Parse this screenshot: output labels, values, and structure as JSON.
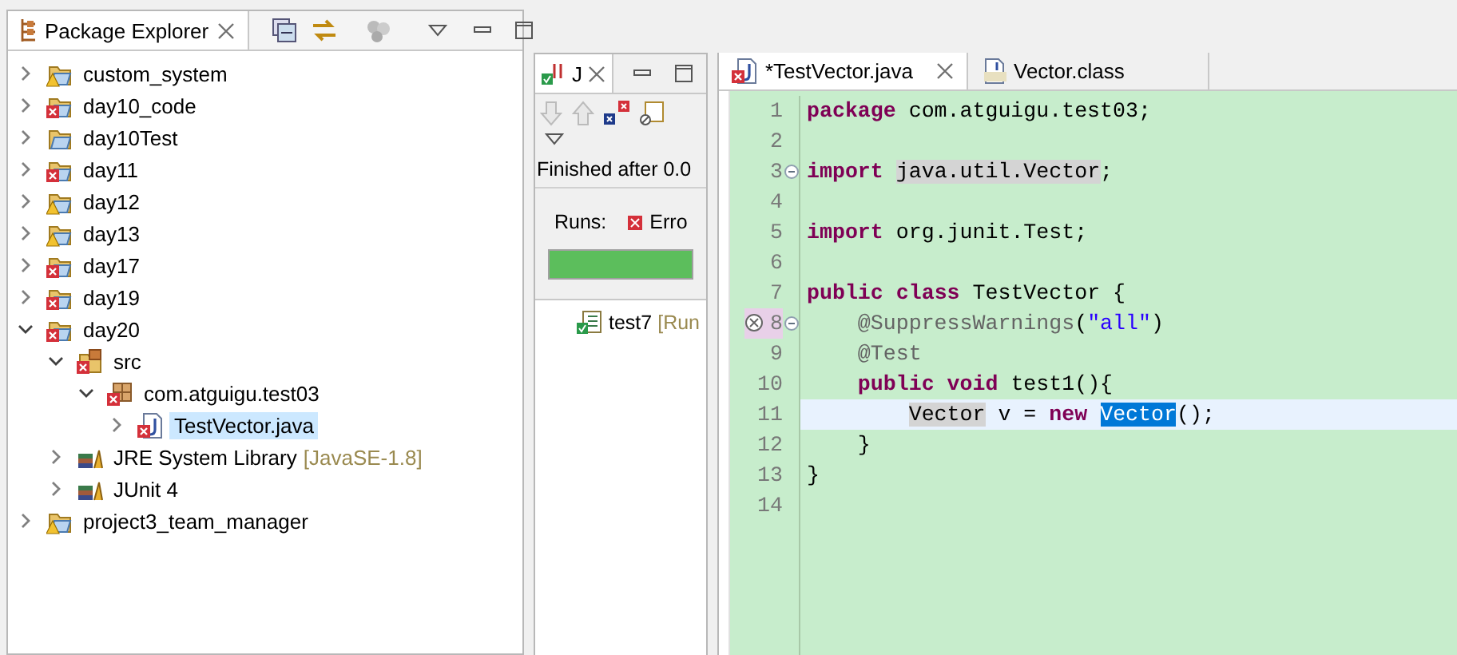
{
  "package_explorer": {
    "title": "Package Explorer",
    "items": [
      {
        "label": "custom_system",
        "kind": "project",
        "error": false,
        "warning": true,
        "expanded": false,
        "selected": false
      },
      {
        "label": "day10_code",
        "kind": "project",
        "error": true,
        "warning": false,
        "expanded": false,
        "selected": false
      },
      {
        "label": "day10Test",
        "kind": "project",
        "error": false,
        "warning": false,
        "expanded": false,
        "selected": false
      },
      {
        "label": "day11",
        "kind": "project",
        "error": true,
        "warning": false,
        "expanded": false,
        "selected": false
      },
      {
        "label": "day12",
        "kind": "project",
        "error": false,
        "warning": true,
        "expanded": false,
        "selected": false
      },
      {
        "label": "day13",
        "kind": "project",
        "error": false,
        "warning": true,
        "expanded": false,
        "selected": false
      },
      {
        "label": "day17",
        "kind": "project",
        "error": true,
        "warning": false,
        "expanded": false,
        "selected": false
      },
      {
        "label": "day19",
        "kind": "project",
        "error": true,
        "warning": false,
        "expanded": false,
        "selected": false
      },
      {
        "label": "day20",
        "kind": "project",
        "error": true,
        "warning": false,
        "expanded": true,
        "selected": false,
        "children": [
          {
            "label": "src",
            "kind": "folder",
            "error": true,
            "warning": false,
            "expanded": true,
            "selected": false,
            "children": [
              {
                "label": "com.atguigu.test03",
                "kind": "package",
                "error": true,
                "warning": false,
                "expanded": true,
                "selected": false,
                "children": [
                  {
                    "label": "TestVector.java",
                    "kind": "file",
                    "error": true,
                    "warning": false,
                    "expanded": false,
                    "selected": true
                  }
                ]
              }
            ]
          },
          {
            "label": "JRE System Library",
            "suffix": "[JavaSE-1.8]",
            "kind": "library",
            "error": false,
            "warning": false,
            "expanded": false,
            "selected": false
          },
          {
            "label": "JUnit 4",
            "kind": "library",
            "error": false,
            "warning": false,
            "expanded": false,
            "selected": false
          }
        ]
      },
      {
        "label": "project3_team_manager",
        "kind": "project",
        "error": false,
        "warning": true,
        "expanded": false,
        "selected": false
      }
    ]
  },
  "junit": {
    "tab_label": "J",
    "status": "Finished after 0.0",
    "runs_label": "Runs:",
    "errors_label": "Erro",
    "progress": {
      "level": 1
    },
    "tests": [
      {
        "label": "test7",
        "suffix": "[Run"
      }
    ]
  },
  "editor": {
    "tabs": [
      {
        "label": "*TestVector.java",
        "kind": "source",
        "selected": true
      },
      {
        "label": "Vector.class",
        "kind": "binary",
        "selected": false
      }
    ],
    "lines": [
      {
        "number": "1",
        "tokens": [
          {
            "text": "package ",
            "kind": "keyword"
          },
          {
            "text": "com.atguigu.test03;",
            "kind": "plain"
          }
        ]
      },
      {
        "number": "2"
      },
      {
        "number": "3",
        "fold": true,
        "tokens": [
          {
            "text": "import ",
            "kind": "keyword"
          },
          {
            "text": "java.util.Vector",
            "kind": "occurrence"
          },
          {
            "text": ";",
            "kind": "plain"
          }
        ]
      },
      {
        "number": "4"
      },
      {
        "number": "5",
        "tokens": [
          {
            "text": "import ",
            "kind": "keyword"
          },
          {
            "text": "org.junit.Test;",
            "kind": "plain"
          }
        ]
      },
      {
        "number": "6"
      },
      {
        "number": "7",
        "tokens": [
          {
            "text": "public ",
            "kind": "keyword"
          },
          {
            "text": "class ",
            "kind": "keyword"
          },
          {
            "text": "TestVector {",
            "kind": "plain"
          }
        ]
      },
      {
        "number": "8",
        "fold": true,
        "error": true,
        "tokens": [
          {
            "text": "    @SuppressWarnings",
            "kind": "annotation"
          },
          {
            "text": "(",
            "kind": "plain"
          },
          {
            "text": "\"all\"",
            "kind": "string"
          },
          {
            "text": ")",
            "kind": "plain"
          }
        ]
      },
      {
        "number": "9",
        "tokens": [
          {
            "text": "    @Test",
            "kind": "annotation"
          }
        ]
      },
      {
        "number": "10",
        "tokens": [
          {
            "text": "    public ",
            "kind": "keyword"
          },
          {
            "text": "void ",
            "kind": "keyword"
          },
          {
            "text": "test1(){",
            "kind": "plain"
          }
        ]
      },
      {
        "number": "11",
        "current": true,
        "tokens": [
          {
            "text": "        Vector",
            "kind": "occurrence"
          },
          {
            "text": " v = ",
            "kind": "plain"
          },
          {
            "text": "new ",
            "kind": "keyword"
          },
          {
            "text": "Vector",
            "kind": "selection"
          },
          {
            "text": "();",
            "kind": "plain"
          }
        ]
      },
      {
        "number": "12",
        "tokens": [
          {
            "text": "    }",
            "kind": "plain"
          }
        ]
      },
      {
        "number": "13",
        "tokens": [
          {
            "text": "}",
            "kind": "plain"
          }
        ]
      },
      {
        "number": "14"
      }
    ]
  }
}
